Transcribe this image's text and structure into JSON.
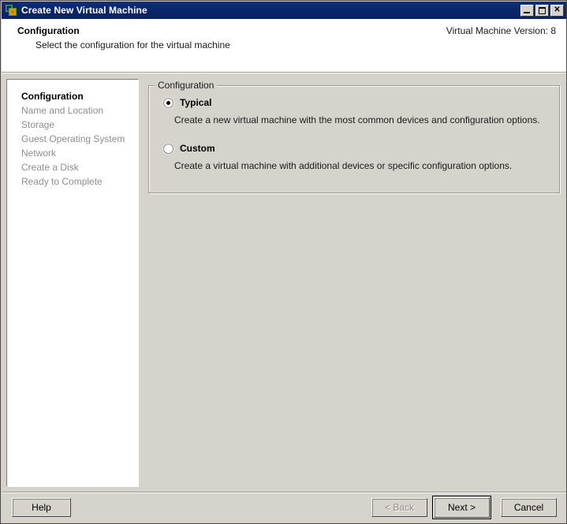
{
  "window": {
    "title": "Create New Virtual Machine",
    "icon": "virtual-machine-icon",
    "controls": {
      "minimize": "Minimize",
      "maximize": "Maximize",
      "close": "Close"
    }
  },
  "header": {
    "title": "Configuration",
    "subtitle": "Select the configuration for the virtual machine",
    "version_label": "Virtual Machine Version: 8"
  },
  "sidebar": {
    "items": [
      {
        "label": "Configuration",
        "active": true
      },
      {
        "label": "Name and Location",
        "active": false
      },
      {
        "label": "Storage",
        "active": false
      },
      {
        "label": "Guest Operating System",
        "active": false
      },
      {
        "label": "Network",
        "active": false
      },
      {
        "label": "Create a Disk",
        "active": false
      },
      {
        "label": "Ready to Complete",
        "active": false
      }
    ]
  },
  "main": {
    "groupbox_legend": "Configuration",
    "options": [
      {
        "label": "Typical",
        "description": "Create a new virtual machine with the most common devices and configuration options.",
        "selected": true
      },
      {
        "label": "Custom",
        "description": "Create a virtual machine with additional devices or specific configuration options.",
        "selected": false
      }
    ]
  },
  "footer": {
    "help": "Help",
    "back": "< Back",
    "next": "Next >",
    "cancel": "Cancel"
  },
  "colors": {
    "titlebar": "#0a2568",
    "dialog_face": "#d6d3cd",
    "panel_white": "#ffffff",
    "disabled_text": "#8e8b86",
    "nav_inactive": "#8e8e8e"
  }
}
